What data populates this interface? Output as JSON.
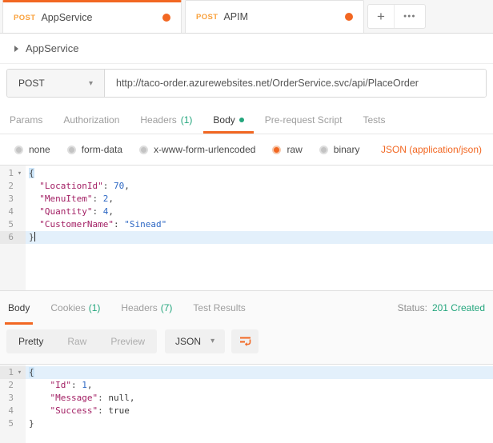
{
  "colors": {
    "accent": "#F26722",
    "green": "#24A67D",
    "method": "#F9A13C",
    "key": "#A21E63",
    "val": "#2E68C4"
  },
  "icons": {
    "chevron_down": "▾",
    "plus": "+",
    "more": "●●●",
    "fold": "▾"
  },
  "tabbar": {
    "tabs": [
      {
        "method": "POST",
        "name": "AppService",
        "active": true,
        "dirty": true
      },
      {
        "method": "POST",
        "name": "APIM",
        "active": false,
        "dirty": true
      }
    ]
  },
  "request": {
    "title": "AppService",
    "method": "POST",
    "url": "http://taco-order.azurewebsites.net/OrderService.svc/api/PlaceOrder",
    "tabs": [
      {
        "label": "Params"
      },
      {
        "label": "Authorization"
      },
      {
        "label": "Headers",
        "count": "(1)"
      },
      {
        "label": "Body",
        "active": true,
        "dot": true
      },
      {
        "label": "Pre-request Script"
      },
      {
        "label": "Tests"
      }
    ],
    "body_types": [
      {
        "label": "none"
      },
      {
        "label": "form-data"
      },
      {
        "label": "x-www-form-urlencoded"
      },
      {
        "label": "raw",
        "selected": true
      },
      {
        "label": "binary"
      }
    ],
    "content_type": "JSON (application/json)"
  },
  "request_editor": {
    "lines": [
      {
        "num": "1",
        "fold": true,
        "tokens": [
          {
            "t": "b",
            "v": "{"
          }
        ]
      },
      {
        "num": "2",
        "tokens": [
          {
            "t": "p",
            "v": "  "
          },
          {
            "t": "k",
            "v": "\"LocationId\""
          },
          {
            "t": "p",
            "v": ": "
          },
          {
            "t": "v",
            "v": "70"
          },
          {
            "t": "p",
            "v": ","
          }
        ]
      },
      {
        "num": "3",
        "tokens": [
          {
            "t": "p",
            "v": "  "
          },
          {
            "t": "k",
            "v": "\"MenuItem\""
          },
          {
            "t": "p",
            "v": ": "
          },
          {
            "t": "v",
            "v": "2"
          },
          {
            "t": "p",
            "v": ","
          }
        ]
      },
      {
        "num": "4",
        "tokens": [
          {
            "t": "p",
            "v": "  "
          },
          {
            "t": "k",
            "v": "\"Quantity\""
          },
          {
            "t": "p",
            "v": ": "
          },
          {
            "t": "v",
            "v": "4"
          },
          {
            "t": "p",
            "v": ","
          }
        ]
      },
      {
        "num": "5",
        "tokens": [
          {
            "t": "p",
            "v": "  "
          },
          {
            "t": "k",
            "v": "\"CustomerName\""
          },
          {
            "t": "p",
            "v": ": "
          },
          {
            "t": "v",
            "v": "\"Sinead\""
          }
        ]
      },
      {
        "num": "6",
        "active": true,
        "cursor": true,
        "tokens": [
          {
            "t": "p",
            "v": "}"
          }
        ]
      }
    ]
  },
  "response": {
    "tabs": [
      {
        "label": "Body",
        "active": true
      },
      {
        "label": "Cookies",
        "count": "(1)"
      },
      {
        "label": "Headers",
        "count": "(7)"
      },
      {
        "label": "Test Results"
      }
    ],
    "status_label": "Status:",
    "status_value": "201 Created",
    "view_modes": [
      {
        "label": "Pretty",
        "active": true
      },
      {
        "label": "Raw"
      },
      {
        "label": "Preview"
      }
    ],
    "format": "JSON"
  },
  "response_editor": {
    "lines": [
      {
        "num": "1",
        "fold": true,
        "active": true,
        "tokens": [
          {
            "t": "b",
            "v": "{"
          }
        ]
      },
      {
        "num": "2",
        "tokens": [
          {
            "t": "p",
            "v": "    "
          },
          {
            "t": "k",
            "v": "\"Id\""
          },
          {
            "t": "p",
            "v": ": "
          },
          {
            "t": "v",
            "v": "1"
          },
          {
            "t": "p",
            "v": ","
          }
        ]
      },
      {
        "num": "3",
        "tokens": [
          {
            "t": "p",
            "v": "    "
          },
          {
            "t": "k",
            "v": "\"Message\""
          },
          {
            "t": "p",
            "v": ": "
          },
          {
            "t": "a",
            "v": "null"
          },
          {
            "t": "p",
            "v": ","
          }
        ]
      },
      {
        "num": "4",
        "tokens": [
          {
            "t": "p",
            "v": "    "
          },
          {
            "t": "k",
            "v": "\"Success\""
          },
          {
            "t": "p",
            "v": ": "
          },
          {
            "t": "a",
            "v": "true"
          }
        ]
      },
      {
        "num": "5",
        "tokens": [
          {
            "t": "p",
            "v": "}"
          }
        ]
      }
    ]
  }
}
